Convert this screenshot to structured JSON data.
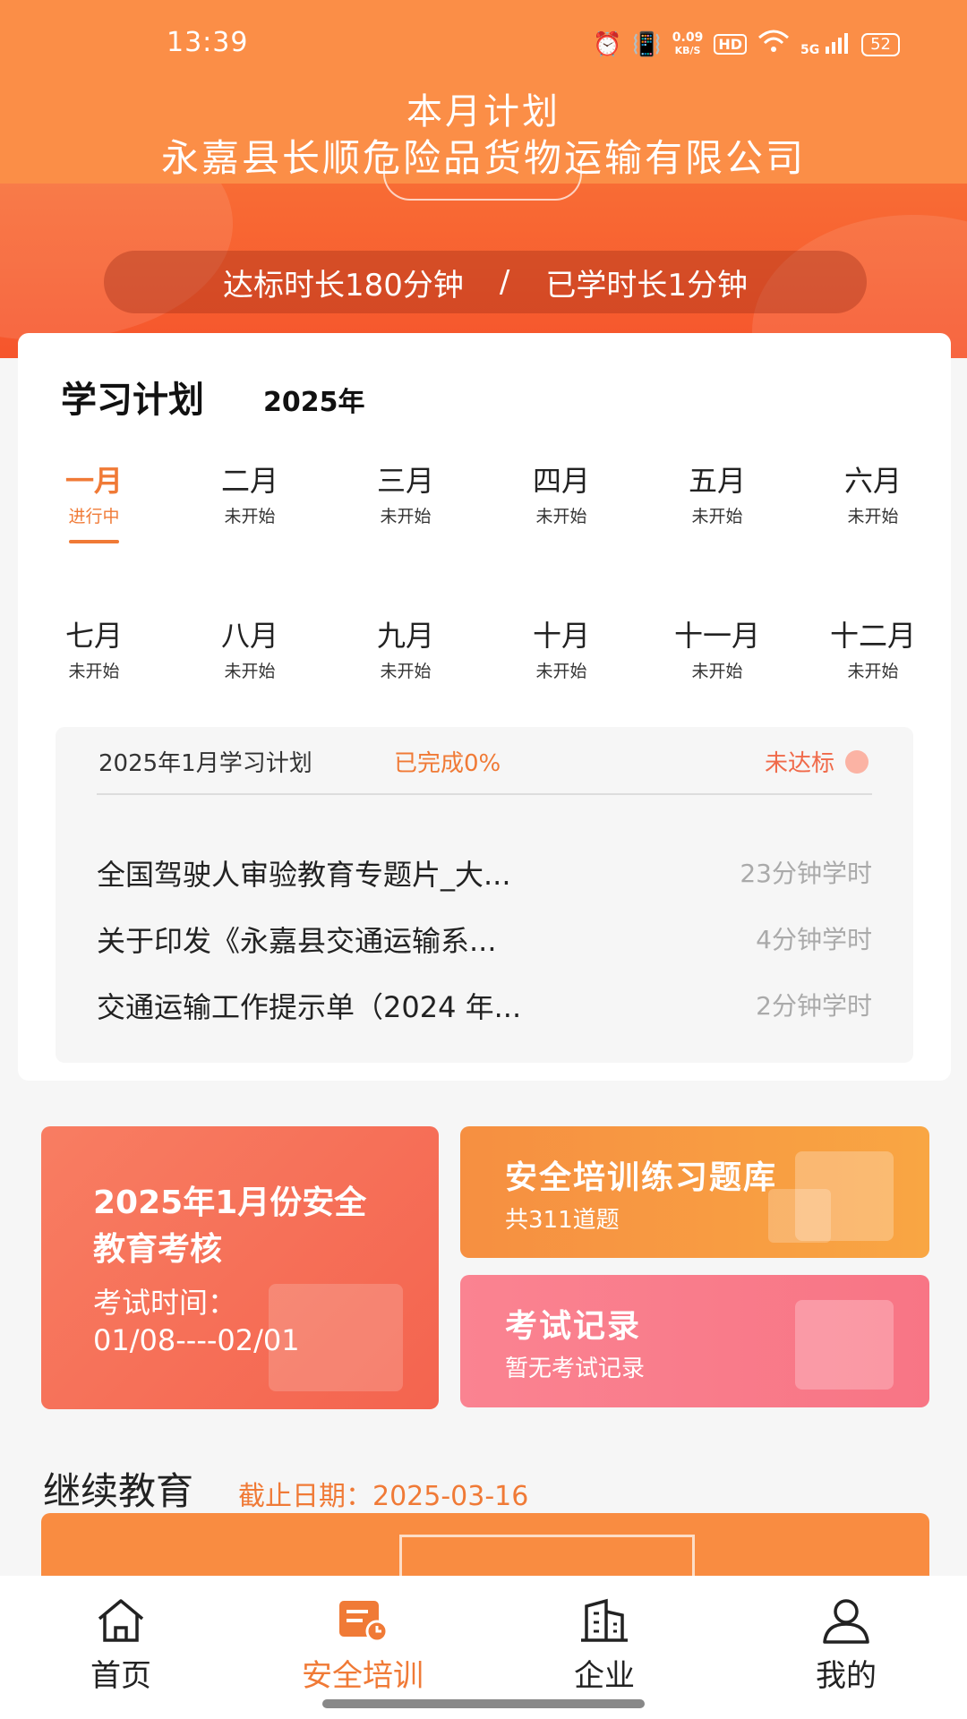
{
  "status": {
    "time": "13:39",
    "net_speed": "0.09",
    "net_unit": "KB/S",
    "hd": "HD",
    "signal": "5G",
    "battery": "52"
  },
  "header": {
    "title": "本月计划",
    "company": "永嘉县长顺危险品货物运输有限公司"
  },
  "duration": {
    "target": "达标时长180分钟",
    "separator": "/",
    "learned": "已学时长1分钟"
  },
  "plan": {
    "title": "学习计划",
    "year": "2025年",
    "months": [
      {
        "name": "一月",
        "status": "进行中"
      },
      {
        "name": "二月",
        "status": "未开始"
      },
      {
        "name": "三月",
        "status": "未开始"
      },
      {
        "name": "四月",
        "status": "未开始"
      },
      {
        "name": "五月",
        "status": "未开始"
      },
      {
        "name": "六月",
        "status": "未开始"
      },
      {
        "name": "七月",
        "status": "未开始"
      },
      {
        "name": "八月",
        "status": "未开始"
      },
      {
        "name": "九月",
        "status": "未开始"
      },
      {
        "name": "十月",
        "status": "未开始"
      },
      {
        "name": "十一月",
        "status": "未开始"
      },
      {
        "name": "十二月",
        "status": "未开始"
      }
    ],
    "box": {
      "heading": "2025年1月学习计划",
      "completed": "已完成0%",
      "status": "未达标",
      "lessons": [
        {
          "title": "全国驾驶人审验教育专题片_大...",
          "hours": "23分钟学时"
        },
        {
          "title": "关于印发《永嘉县交通运输系...",
          "hours": "4分钟学时"
        },
        {
          "title": "交通运输工作提示单（2024 年...",
          "hours": "2分钟学时"
        }
      ]
    }
  },
  "tiles": {
    "exam": {
      "title": "2025年1月份安全教育考核",
      "time_label": "考试时间：",
      "time_range": "01/08----02/01"
    },
    "bank": {
      "title": "安全培训练习题库",
      "subtitle": "共311道题"
    },
    "record": {
      "title": "考试记录",
      "subtitle": "暂无考试记录"
    }
  },
  "continuing": {
    "title": "继续教育",
    "deadline": "截止日期：2025-03-16"
  },
  "nav": [
    {
      "label": "首页",
      "icon": "home-icon"
    },
    {
      "label": "安全培训",
      "icon": "training-icon"
    },
    {
      "label": "企业",
      "icon": "building-icon"
    },
    {
      "label": "我的",
      "icon": "user-icon"
    }
  ],
  "colors": {
    "accent": "#f07a36",
    "header": "#fb8e47"
  }
}
